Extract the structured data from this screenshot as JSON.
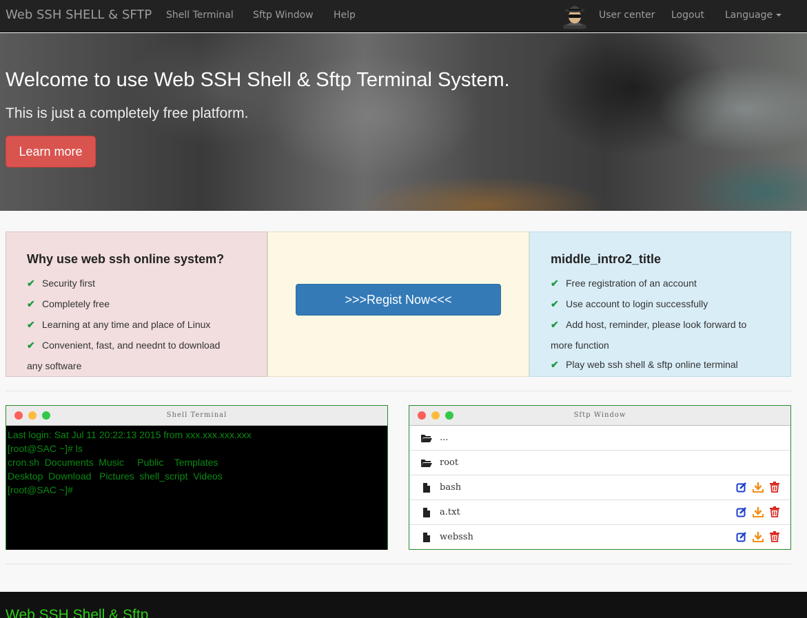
{
  "navbar": {
    "brand": "Web SSH SHELL & SFTP",
    "links": [
      "Shell Terminal",
      "Sftp Window",
      "Help"
    ],
    "user_center": "User center",
    "logout": "Logout",
    "language": "Language",
    "avatar_icon": "spy-avatar-icon"
  },
  "hero": {
    "title": "Welcome to use Web SSH Shell & Sftp Terminal System.",
    "subtitle": "This is just a completely free platform.",
    "button": "Learn more"
  },
  "intro": {
    "left": {
      "title": "Why use web ssh online system?",
      "items": [
        "Security first",
        "Completely free",
        "Learning at any time and place of Linux",
        "Convenient, fast, and neednt to download"
      ],
      "trailing_text": "any software"
    },
    "middle": {
      "button": ">>>Regist Now<<<"
    },
    "right": {
      "title": "middle_intro2_title",
      "items": [
        "Free registration of an account",
        "Use account to login successfully",
        "Add host, reminder, please look forward to"
      ],
      "trailing_text": "more function",
      "last_item": "Play web ssh shell & sftp online terminal"
    }
  },
  "shell": {
    "title": "Shell Terminal",
    "lines": [
      "Last login: Sat Jul 11 20:22:13 2015 from xxx.xxx.xxx.xxx",
      "[root@SAC ~]# ls",
      "cron.sh  Documents  Music     Public    Templates",
      "Desktop  Download   Pictures  shell_script  Videos",
      "[root@SAC ~]#"
    ]
  },
  "sftp": {
    "title": "Sftp Window",
    "rows": [
      {
        "name": "...",
        "type": "folder"
      },
      {
        "name": "root",
        "type": "folder"
      },
      {
        "name": "bash",
        "type": "file"
      },
      {
        "name": "a.txt",
        "type": "file"
      },
      {
        "name": "webssh",
        "type": "file"
      }
    ]
  },
  "colors": {
    "accent_red": "#d9534f",
    "accent_blue": "#337ab7",
    "terminal_green": "#0a8a14",
    "footer_green": "#2ecc1a"
  },
  "footer": {
    "title": "Web SSH Shell & Sftp"
  }
}
